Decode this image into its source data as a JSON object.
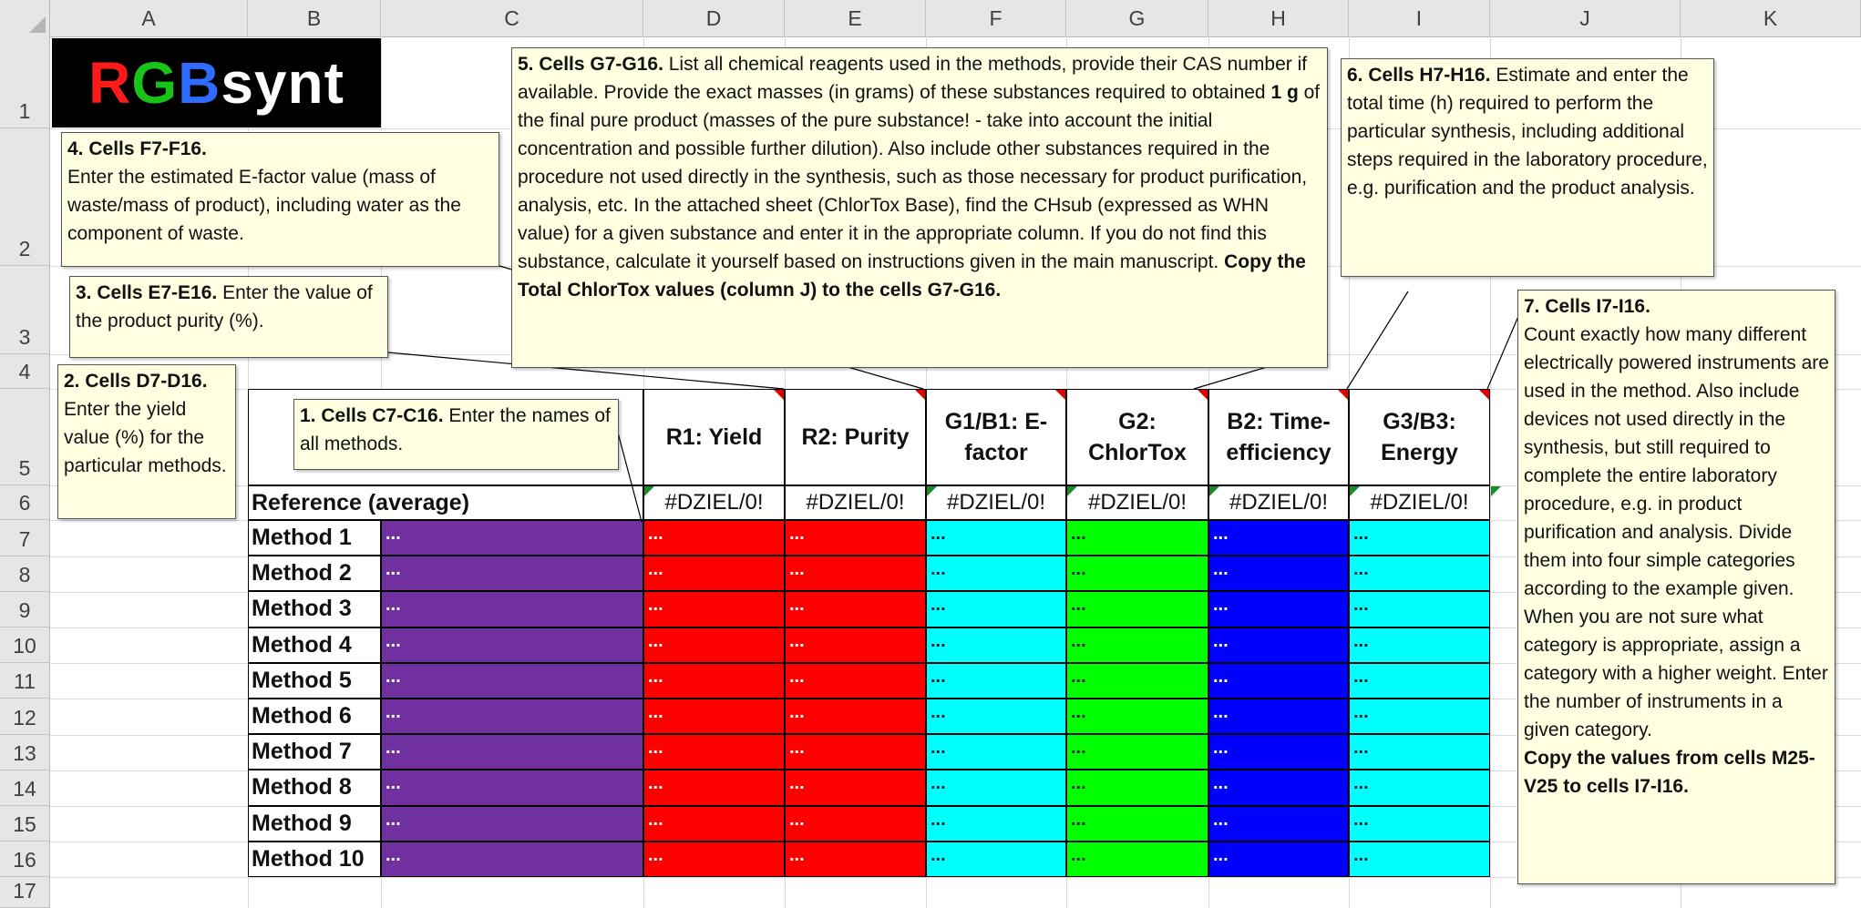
{
  "columns": [
    "A",
    "B",
    "C",
    "D",
    "E",
    "F",
    "G",
    "H",
    "I",
    "J",
    "K"
  ],
  "rows": [
    "1",
    "2",
    "3",
    "4",
    "5",
    "6",
    "7",
    "8",
    "9",
    "10",
    "11",
    "12",
    "13",
    "14",
    "15",
    "16",
    "17"
  ],
  "logo": {
    "r": "R",
    "g": "G",
    "b": "B",
    "rest": "synt"
  },
  "table": {
    "headers": [
      "R1: Yield",
      "R2: Purity",
      "G1/B1: E-factor",
      "G2: ChlorTox",
      "B2: Time-efficiency",
      "G3/B3: Energy"
    ],
    "reference_label": "Reference (average)",
    "reference_values": [
      "#DZIEL/0!",
      "#DZIEL/0!",
      "#DZIEL/0!",
      "#DZIEL/0!",
      "#DZIEL/0!",
      "#DZIEL/0!"
    ],
    "methods": [
      "Method 1",
      "Method 2",
      "Method 3",
      "Method 4",
      "Method 5",
      "Method 6",
      "Method 7",
      "Method 8",
      "Method 9",
      "Method 10"
    ],
    "placeholder": "...",
    "colors": {
      "names": "#7030a0",
      "yield": "#ff0000",
      "purity": "#ff0000",
      "efactor": "#00ffff",
      "chlortox": "#00ff00",
      "time": "#0000ff",
      "energy": "#00ffff"
    }
  },
  "comments": {
    "c1": {
      "title": "1. Cells C7-C16.",
      "body": " Enter the names of all methods."
    },
    "c2": {
      "title": "2. Cells D7-D16.",
      "body": " Enter the yield value (%) for the particular methods."
    },
    "c3": {
      "title": "3. Cells E7-E16.",
      "body": " Enter the value of the product purity (%)."
    },
    "c4": {
      "title": "4. Cells F7-F16.",
      "body": "Enter the estimated E-factor value (mass of waste/mass of product), including water as the component of waste."
    },
    "c5": {
      "title": "5. Cells G7-G16.",
      "body1": " List all chemical reagents used in the methods, provide their CAS number if available. Provide the exact masses (in grams) of these substances required to obtained ",
      "bold_mid": "1 g",
      "body2": " of the final pure product (masses of the pure substance! - take into account the initial concentration and possible further dilution). Also include other substances required in the procedure not used directly in the synthesis, such as those necessary for product purification, analysis, etc. In the attached sheet (ChlorTox Base), find the CHsub (expressed as WHN value) for a given substance and enter it in the appropriate column. If you do not find this substance, calculate it yourself based on instructions given in the main manuscript. ",
      "bold_end": "Copy the Total ChlorTox values (column J) to the cells G7-G16."
    },
    "c6": {
      "title": "6. Cells H7-H16.",
      "body": " Estimate and enter the total time (h) required to perform the particular synthesis, including additional steps required in the laboratory procedure, e.g. purification and the product analysis."
    },
    "c7": {
      "title": "7. Cells I7-I16.",
      "body": "Count exactly how many different electrically powered instruments are used in the method. Also include devices not used directly in the synthesis, but still required to complete the entire laboratory procedure, e.g. in product purification and analysis. Divide them into four simple categories according to the example given. When you are not sure what category is appropriate, assign a category with a higher weight. Enter the number of instruments in a given category.",
      "bold_end": "Copy the values from cells M25-V25 to cells I7-I16."
    }
  }
}
